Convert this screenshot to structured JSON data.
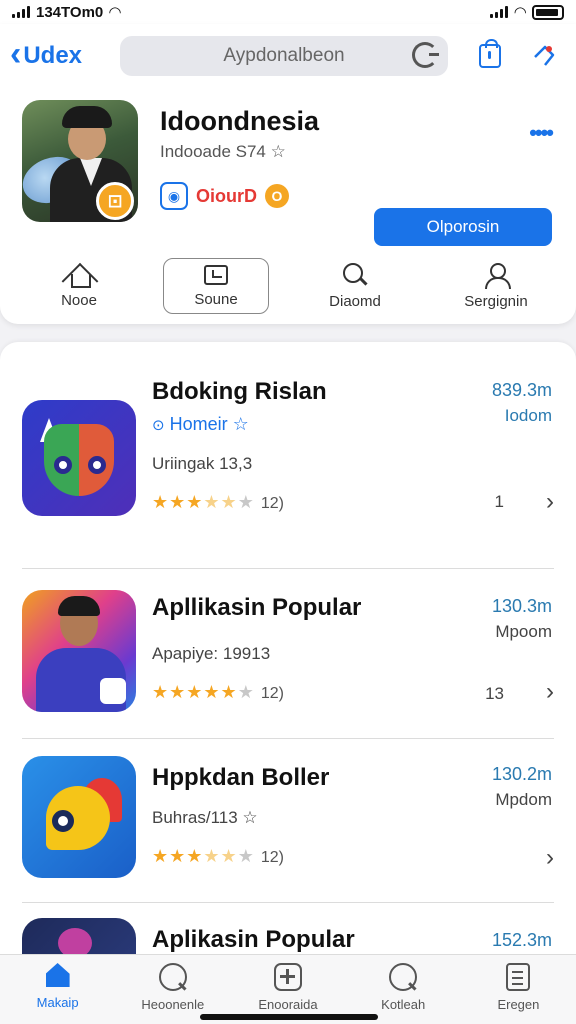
{
  "status_bar": {
    "time": "134TOm0"
  },
  "nav": {
    "back_label": "Udex",
    "search_placeholder": "Aypdonalbeon"
  },
  "featured": {
    "title": "Idoondnesia",
    "subtitle": "Indooade S74 ☆",
    "brand": "OiourD",
    "badge_letter": "O",
    "primary_button": "Olporosin",
    "more": "••••"
  },
  "categories": [
    {
      "label": "Nooe",
      "icon": "home-icon"
    },
    {
      "label": "Soune",
      "icon": "frame-icon"
    },
    {
      "label": "Diaomd",
      "icon": "search-icon"
    },
    {
      "label": "Sergignin",
      "icon": "person-icon"
    }
  ],
  "apps": [
    {
      "title": "Bdoking Rislan",
      "developer": "Homeir ☆",
      "meta": "Uriingak 13,3",
      "rating": 3.5,
      "rating_count": "12)",
      "size": "839.3m",
      "size_unit": "Iodom",
      "rank": "1"
    },
    {
      "title": "Apllikasin Popular",
      "developer": "",
      "meta": "Apapiye: 19913",
      "rating": 5,
      "rating_count": "12)",
      "size": "130.3m",
      "size_unit": "Mpoom",
      "rank": "13"
    },
    {
      "title": "Hppkdan Boller",
      "developer": "",
      "meta": "Buhras/113 ☆",
      "rating": 3.5,
      "rating_count": "12)",
      "size": "130.2m",
      "size_unit": "Mpdom",
      "rank": ""
    },
    {
      "title": "Aplikasin Popular",
      "developer": "",
      "meta": "",
      "rating": 0,
      "rating_count": "",
      "size": "152.3m",
      "size_unit": "",
      "rank": ""
    }
  ],
  "tab_bar": [
    {
      "label": "Makaip",
      "icon": "home-icon",
      "active": true
    },
    {
      "label": "Heoonenle",
      "icon": "search-icon",
      "active": false
    },
    {
      "label": "Enooraida",
      "icon": "plus-icon",
      "active": false
    },
    {
      "label": "Kotleah",
      "icon": "search-icon",
      "active": false
    },
    {
      "label": "Eregen",
      "icon": "document-icon",
      "active": false
    }
  ]
}
